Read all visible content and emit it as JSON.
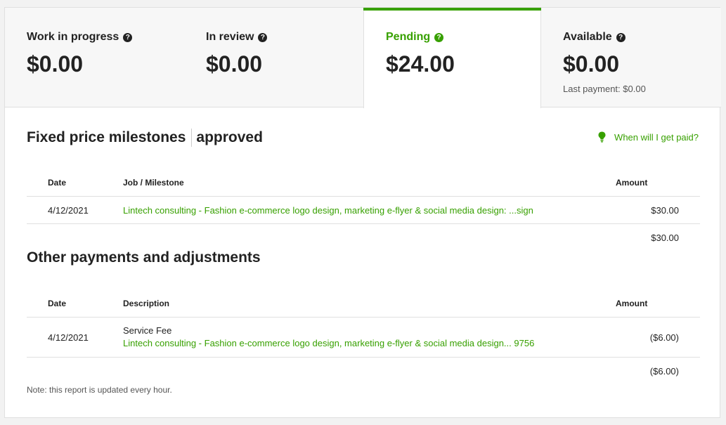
{
  "tabs": [
    {
      "label": "Work in progress",
      "value": "$0.00",
      "sub": ""
    },
    {
      "label": "In review",
      "value": "$0.00",
      "sub": ""
    },
    {
      "label": "Pending",
      "value": "$24.00",
      "sub": ""
    },
    {
      "label": "Available",
      "value": "$0.00",
      "sub": "Last payment: $0.00"
    }
  ],
  "help_icon_glyph": "?",
  "milestones": {
    "title": "Fixed price milestones",
    "title_suffix": "approved",
    "paid_link": "When will I get paid?",
    "headers": {
      "date": "Date",
      "job": "Job / Milestone",
      "amount": "Amount"
    },
    "rows": [
      {
        "date": "4/12/2021",
        "job": "Lintech consulting - Fashion e-commerce logo design, marketing e-flyer & social media design: ...sign",
        "amount": "$30.00"
      }
    ],
    "total": "$30.00"
  },
  "other": {
    "title": "Other payments and adjustments",
    "headers": {
      "date": "Date",
      "description": "Description",
      "amount": "Amount"
    },
    "rows": [
      {
        "date": "4/12/2021",
        "type": "Service Fee",
        "description": "Lintech consulting - Fashion e-commerce logo design, marketing e-flyer & social media design... 9756",
        "amount": "($6.00)"
      }
    ],
    "total": "($6.00)"
  },
  "note": "Note: this report is updated every hour.",
  "colors": {
    "accent": "#37a000",
    "text": "#222222",
    "muted": "#555555",
    "background": "#f2f2f2"
  },
  "icons": {
    "help": "question-circle-icon",
    "bulb": "lightbulb-icon"
  }
}
